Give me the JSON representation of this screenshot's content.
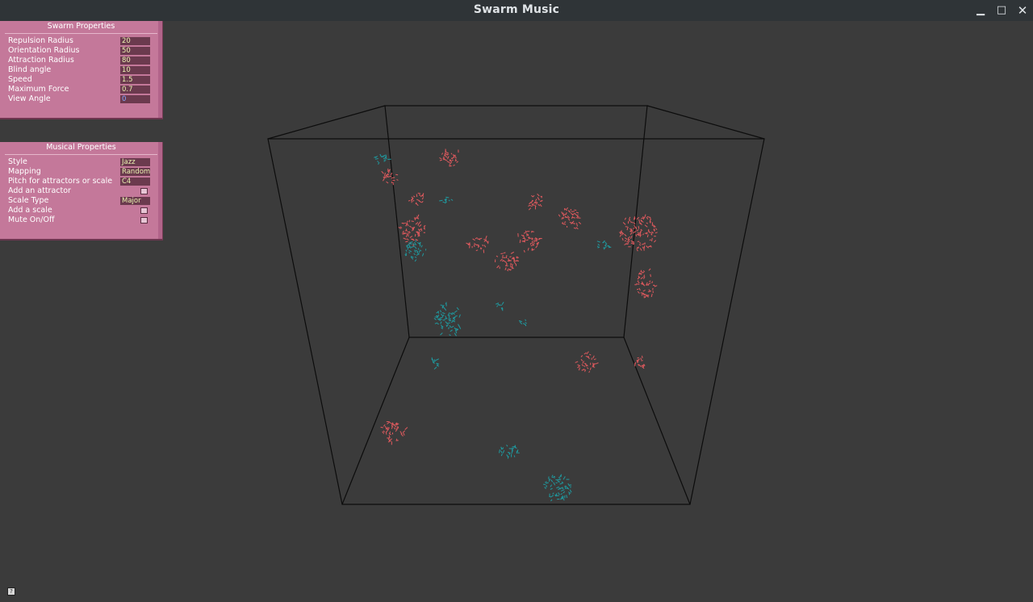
{
  "window": {
    "title": "Swarm Music",
    "minimize_icon": "minimize-icon",
    "maximize_icon": "maximize-icon",
    "close_icon": "close-icon"
  },
  "swarm_panel": {
    "title": "Swarm Properties",
    "rows": [
      {
        "label": "Repulsion Radius",
        "value": "20"
      },
      {
        "label": "Orientation Radius",
        "value": "50"
      },
      {
        "label": "Attraction Radius",
        "value": "80"
      },
      {
        "label": "Blind angle",
        "value": "10"
      },
      {
        "label": "Speed",
        "value": "1.5"
      },
      {
        "label": "Maximum Force",
        "value": "0.7"
      },
      {
        "label": "View Angle",
        "value": "0"
      }
    ]
  },
  "music_panel": {
    "title": "Musical Properties",
    "rows": [
      {
        "label": "Style",
        "value": "Jazz"
      },
      {
        "label": "Mapping",
        "value": "Random"
      },
      {
        "label": "Pitch for attractors or scale",
        "value": "C4"
      },
      {
        "label": "Add an attractor",
        "checkbox": false
      },
      {
        "label": "Scale Type",
        "value": "Major"
      },
      {
        "label": "Add a scale",
        "checkbox": false
      },
      {
        "label": "Mute On/Off",
        "checkbox": false
      }
    ]
  },
  "colors": {
    "background": "#3b3b3b",
    "titlebar": "#2f3437",
    "panel": "#c4789a",
    "swarm_red": "#e05a5e",
    "swarm_teal": "#1f9aa0",
    "cube_edge": "#0c0c0c"
  },
  "bottom_icon": "help-icon"
}
